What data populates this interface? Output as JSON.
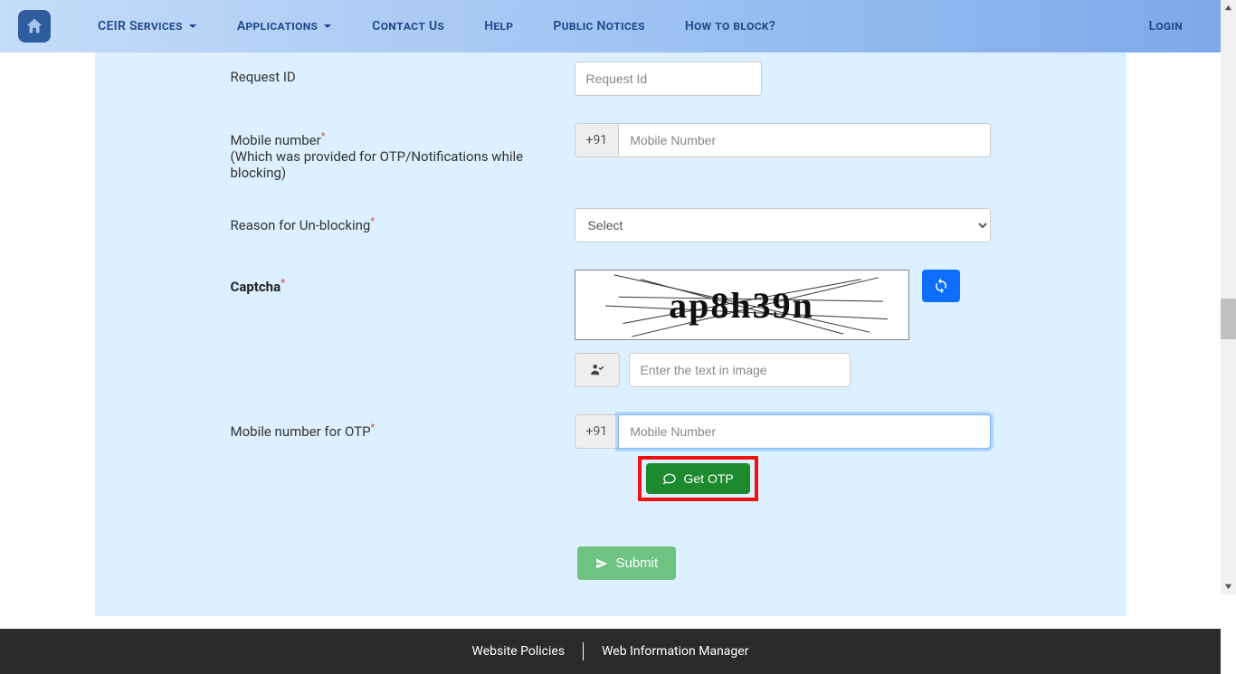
{
  "nav": {
    "ceir_services": "CEIR Services",
    "applications": "Applications",
    "contact": "Contact Us",
    "help": "Help",
    "public_notices": "Public Notices",
    "how_to_block": "How to block?",
    "login": "Login"
  },
  "form": {
    "request_id_label": "Request ID",
    "request_id_placeholder": "Request Id",
    "mobile_label": "Mobile number",
    "mobile_sub": "(Which was provided for OTP/Notifications while blocking)",
    "country_code": "+91",
    "mobile_placeholder": "Mobile Number",
    "reason_label": "Reason for Un-blocking",
    "reason_placeholder": "Select",
    "captcha_label": "Captcha",
    "captcha_text": "ap8h39n",
    "captcha_input_placeholder": "Enter the text in image",
    "otp_mobile_label": "Mobile number for OTP",
    "get_otp": "Get OTP",
    "submit": "Submit"
  },
  "footer": {
    "policies": "Website Policies",
    "wim": "Web Information Manager"
  }
}
